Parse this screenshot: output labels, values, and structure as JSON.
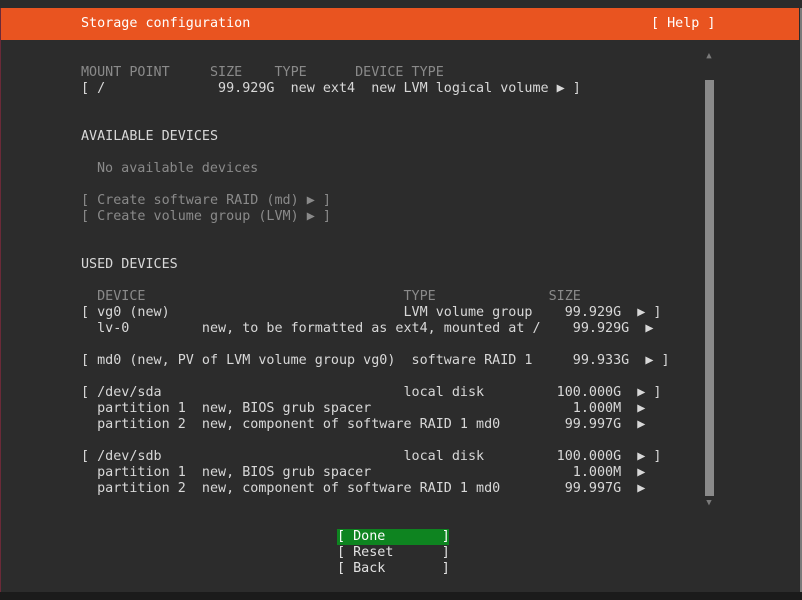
{
  "header": {
    "title": "Storage configuration",
    "help": "[ Help ]"
  },
  "fs_table": {
    "header": "MOUNT POINT     SIZE    TYPE      DEVICE TYPE",
    "row": "[ /              99.929G  new ext4  new LVM logical volume ▶ ]"
  },
  "available": {
    "heading": "AVAILABLE DEVICES",
    "none": "No available devices",
    "raid": "[ Create software RAID (md) ▶ ]",
    "vg": "[ Create volume group (LVM) ▶ ]"
  },
  "used": {
    "heading": "USED DEVICES",
    "header": "  DEVICE                                TYPE              SIZE",
    "lines": [
      "[ vg0 (new)                             LVM volume group    99.929G  ▶ ]",
      "  lv-0         new, to be formatted as ext4, mounted at /    99.929G  ▶",
      "[ md0 (new, PV of LVM volume group vg0)  software RAID 1     99.933G  ▶ ]",
      "[ /dev/sda                              local disk         100.000G  ▶ ]",
      "  partition 1  new, BIOS grub spacer                         1.000M  ▶",
      "  partition 2  new, component of software RAID 1 md0        99.997G  ▶",
      "[ /dev/sdb                              local disk         100.000G  ▶ ]",
      "  partition 1  new, BIOS grub spacer                         1.000M  ▶",
      "  partition 2  new, component of software RAID 1 md0        99.997G  ▶"
    ]
  },
  "scroll": {
    "up": "▲",
    "down": "▼"
  },
  "buttons": {
    "done": "[ Done       ]",
    "reset": "[ Reset      ]",
    "back": "[ Back       ]"
  }
}
